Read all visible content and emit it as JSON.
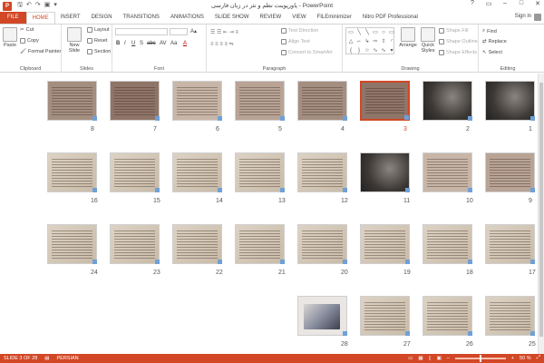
{
  "app": {
    "title": "پاورپوینت نظم و نثر در زبان فارسی - PowerPoint",
    "icon_letter": "P",
    "window_buttons": [
      "?",
      "▭",
      "–",
      "□",
      "✕"
    ]
  },
  "tabs": [
    "FILE",
    "HOME",
    "INSERT",
    "DESIGN",
    "TRANSITIONS",
    "ANIMATIONS",
    "SLIDE SHOW",
    "REVIEW",
    "VIEW",
    "FILEminimizer",
    "Nitro PDF Professional"
  ],
  "active_tab": "HOME",
  "signin": "Sign in",
  "ribbon": {
    "clipboard": {
      "label": "Clipboard",
      "paste": "Paste",
      "cut": "Cut",
      "copy": "Copy",
      "format_painter": "Format Painter"
    },
    "slides": {
      "label": "Slides",
      "new_slide": "New Slide",
      "layout": "Layout",
      "reset": "Reset",
      "section": "Section"
    },
    "font": {
      "label": "Font",
      "bold": "B",
      "italic": "I",
      "underline": "U",
      "shadow": "S",
      "strike": "abc",
      "spacing": "AV",
      "case": "Aa",
      "color": "A"
    },
    "paragraph": {
      "label": "Paragraph",
      "text_direction": "Text Direction",
      "align_text": "Align Text",
      "convert_smartart": "Convert to SmartArt"
    },
    "drawing": {
      "label": "Drawing",
      "arrange": "Arrange",
      "quick_styles": "Quick Styles",
      "shape_fill": "Shape Fill",
      "shape_outline": "Shape Outline",
      "shape_effects": "Shape Effects"
    },
    "editing": {
      "label": "Editing",
      "find": "Find",
      "replace": "Replace",
      "select": "Select"
    }
  },
  "slides": [
    {
      "n": "1",
      "kind": "title-photo"
    },
    {
      "n": "2",
      "kind": "title"
    },
    {
      "n": "3",
      "kind": "text",
      "selected": true
    },
    {
      "n": "4",
      "kind": "text"
    },
    {
      "n": "5",
      "kind": "text"
    },
    {
      "n": "6",
      "kind": "text"
    },
    {
      "n": "7",
      "kind": "text"
    },
    {
      "n": "8",
      "kind": "text"
    },
    {
      "n": "9",
      "kind": "text"
    },
    {
      "n": "10",
      "kind": "text"
    },
    {
      "n": "11",
      "kind": "title"
    },
    {
      "n": "12",
      "kind": "text"
    },
    {
      "n": "13",
      "kind": "text"
    },
    {
      "n": "14",
      "kind": "text"
    },
    {
      "n": "15",
      "kind": "text"
    },
    {
      "n": "16",
      "kind": "text"
    },
    {
      "n": "17",
      "kind": "text"
    },
    {
      "n": "18",
      "kind": "text"
    },
    {
      "n": "19",
      "kind": "text"
    },
    {
      "n": "20",
      "kind": "text"
    },
    {
      "n": "21",
      "kind": "text"
    },
    {
      "n": "22",
      "kind": "text"
    },
    {
      "n": "23",
      "kind": "text"
    },
    {
      "n": "24",
      "kind": "text"
    },
    {
      "n": "25",
      "kind": "text"
    },
    {
      "n": "26",
      "kind": "text"
    },
    {
      "n": "27",
      "kind": "text"
    },
    {
      "n": "28",
      "kind": "photo"
    }
  ],
  "status": {
    "slide_info": "SLIDE 3 OF 28",
    "language": "PERSIAN",
    "zoom": "50 %"
  },
  "colors": {
    "accent": "#d24726"
  }
}
